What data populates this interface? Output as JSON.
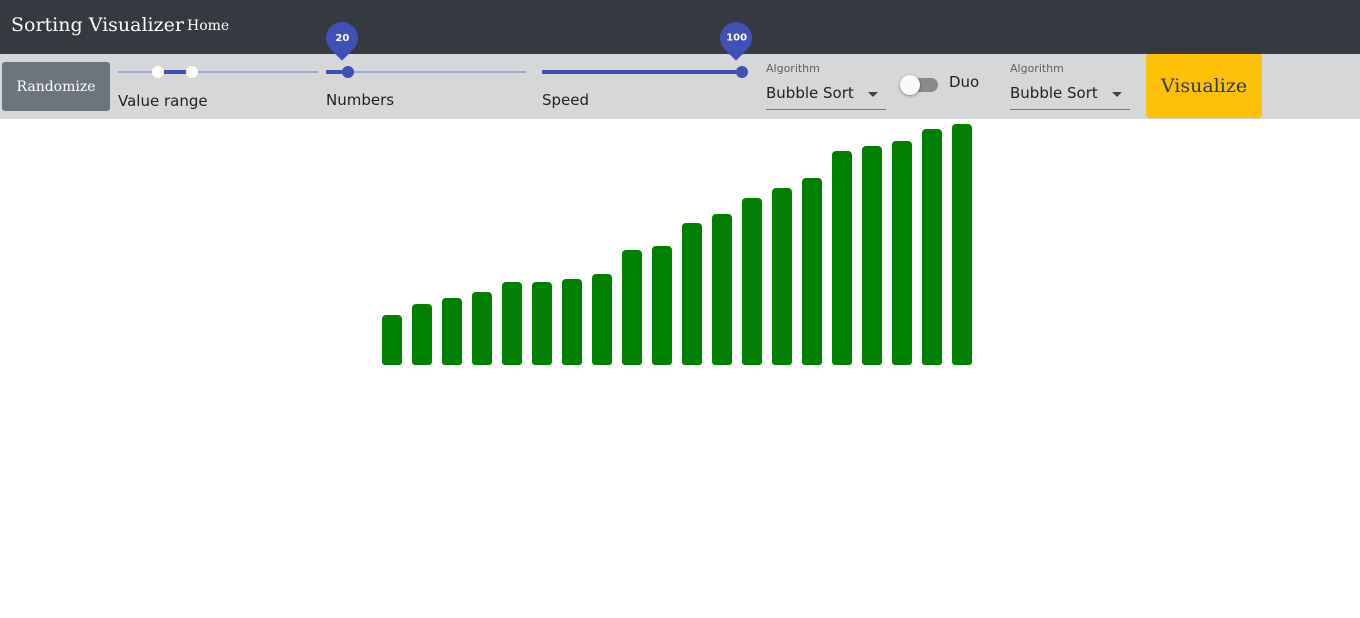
{
  "navbar": {
    "brand": "Sorting Visualizer",
    "home_label": "Home"
  },
  "toolbar": {
    "randomize_label": "Randomize",
    "value_range": {
      "label": "Value range",
      "low": 0.2,
      "high": 0.37
    },
    "numbers": {
      "label": "Numbers",
      "value": "20",
      "fraction": 0.11
    },
    "speed": {
      "label": "Speed",
      "value": "100",
      "fraction": 1.0
    },
    "algorithm_1": {
      "label": "Algorithm",
      "value": "Bubble Sort"
    },
    "duo": {
      "label": "Duo",
      "enabled": false
    },
    "algorithm_2": {
      "label": "Algorithm",
      "value": "Bubble Sort"
    },
    "visualize_label": "Visualize"
  },
  "colors": {
    "navbar": "#343a40",
    "toolbar": "#d6d7d9",
    "accent": "#3f51b5",
    "bar": "#008000",
    "visualize": "#ffc107",
    "randomize": "#6c757d"
  },
  "chart_data": {
    "type": "bar",
    "values": [
      50,
      61,
      67,
      73,
      83,
      83,
      86,
      91,
      115,
      119,
      142,
      151,
      167,
      177,
      187,
      214,
      219,
      224,
      236,
      241
    ],
    "ymax": 241
  }
}
